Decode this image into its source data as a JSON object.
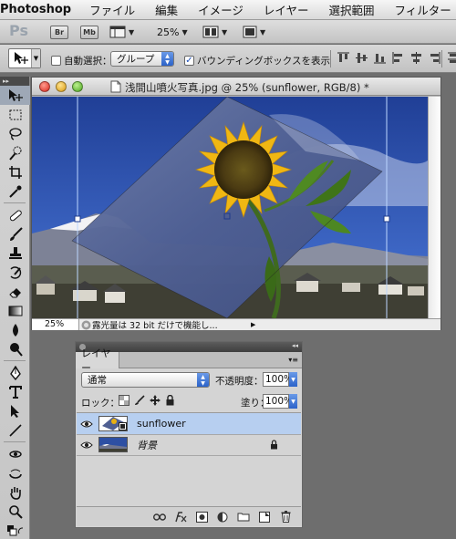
{
  "menubar": {
    "app_name": "Photoshop",
    "items": [
      "ファイル",
      "編集",
      "イメージ",
      "レイヤー",
      "選択範囲",
      "フィルター"
    ]
  },
  "appbar": {
    "logo": "Ps",
    "bridge_label": "Br",
    "minibridge_label": "Mb",
    "zoom": "25%"
  },
  "options": {
    "auto_select_label": "自動選択：",
    "auto_select_checked": false,
    "auto_select_mode": "グループ",
    "bounding_box_label": "バウンディングボックスを表示",
    "bounding_box_checked": true
  },
  "document": {
    "title": "浅間山噴火写真.jpg @ 25% (sunflower, RGB/8) *",
    "zoom": "25%",
    "status_message": "露光量は 32 bit だけで機能し..."
  },
  "layers_panel": {
    "tab_label": "レイヤー",
    "blend_mode": "通常",
    "opacity_label": "不透明度：",
    "opacity_value": "100%",
    "lock_label": "ロック：",
    "fill_label": "塗り：",
    "fill_value": "100%",
    "layers": [
      {
        "name": "sunflower",
        "selected": true,
        "visible": true,
        "locked": false
      },
      {
        "name": "背景",
        "selected": false,
        "visible": true,
        "locked": true
      }
    ]
  },
  "colors": {
    "sky": "#2d4fa3",
    "selection": "#b7cff0",
    "accent": "#2b62c9"
  }
}
